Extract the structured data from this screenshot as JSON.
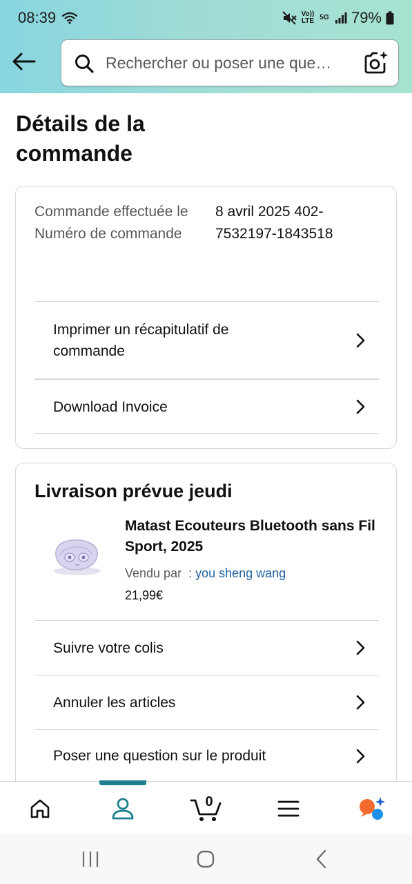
{
  "status_bar": {
    "time": "08:39",
    "volte_label": "Vo)) LTE",
    "network_label": "5G",
    "battery": "79%"
  },
  "search": {
    "placeholder": "Rechercher ou poser une que…"
  },
  "page_title": "Détails de la commande",
  "order_info": {
    "labels": "Commande effectuée le Numéro de commande",
    "values": "8 avril 2025 402-7532197-1843518",
    "rows": [
      {
        "label": "Imprimer un récapitulatif de commande"
      },
      {
        "label": "Download Invoice"
      }
    ]
  },
  "delivery": {
    "title": "Livraison prévue jeudi",
    "product": {
      "title": "Matast Ecouteurs Bluetooth sans Fil Sport, 2025",
      "seller_prefix": "Vendu par  : ",
      "seller_name": "you sheng wang",
      "price": "21,99€"
    },
    "rows": [
      {
        "label": "Suivre votre colis"
      },
      {
        "label": "Annuler les articles"
      },
      {
        "label": "Poser une question sur le produit"
      }
    ]
  },
  "bottom_nav": {
    "items": [
      "home-icon",
      "account-icon",
      "cart-icon",
      "menu-icon",
      "assistant-icon"
    ],
    "cart_count": "0",
    "active_index": 1,
    "accent_color": "#1b7f8c"
  },
  "colors": {
    "link": "#2162a1",
    "header_gradient_start": "#87d6e0",
    "header_gradient_end": "#a7e3d1"
  }
}
